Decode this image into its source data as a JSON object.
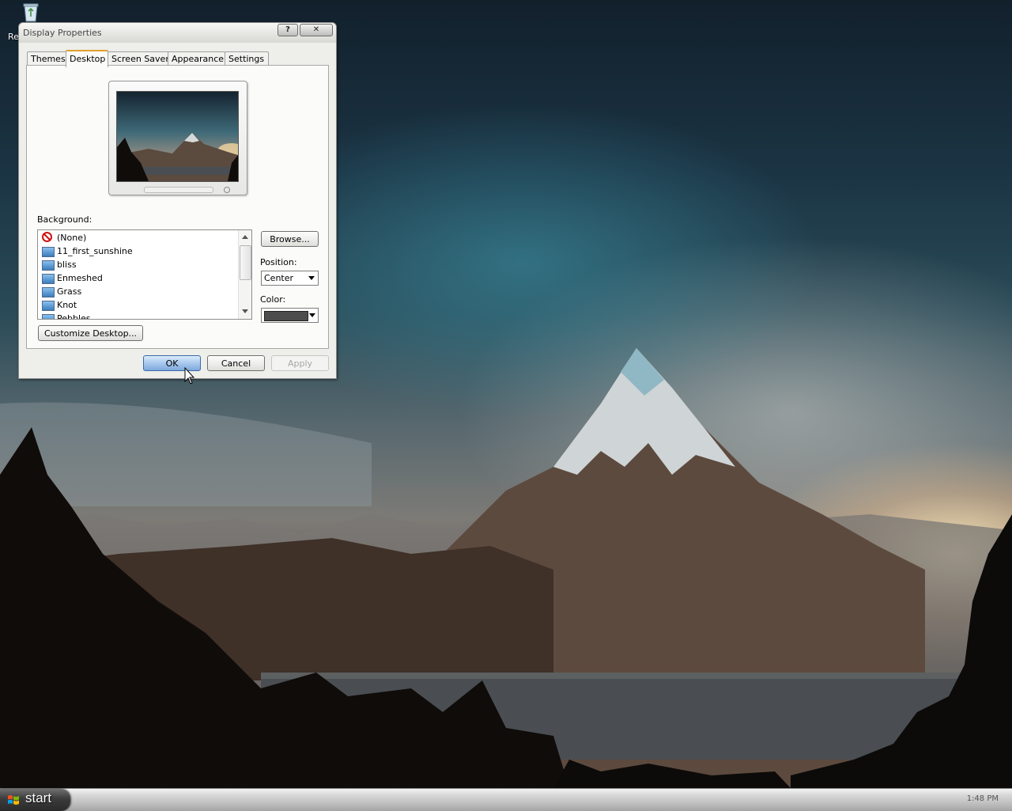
{
  "desktop": {
    "recycle_bin_label": "Re"
  },
  "dialog": {
    "title": "Display Properties",
    "title_buttons": {
      "help": "?",
      "close": "✕"
    },
    "tabs": [
      {
        "label": "Themes",
        "active": false
      },
      {
        "label": "Desktop",
        "active": true
      },
      {
        "label": "Screen Saver",
        "active": false
      },
      {
        "label": "Appearance",
        "active": false
      },
      {
        "label": "Settings",
        "active": false
      }
    ],
    "background_label": "Background:",
    "background_items": [
      {
        "label": "(None)",
        "icon": "no-entry-icon"
      },
      {
        "label": "11_first_sunshine",
        "icon": "image-thumbnail-icon"
      },
      {
        "label": "bliss",
        "icon": "image-thumbnail-icon"
      },
      {
        "label": "Enmeshed",
        "icon": "image-thumbnail-icon"
      },
      {
        "label": "Grass",
        "icon": "image-thumbnail-icon"
      },
      {
        "label": "Knot",
        "icon": "image-thumbnail-icon"
      },
      {
        "label": "Pebbles",
        "icon": "image-thumbnail-icon"
      }
    ],
    "browse_label": "Browse...",
    "position_label": "Position:",
    "position_value": "Center",
    "color_label": "Color:",
    "color_value": "#4c4c4c",
    "customize_label": "Customize Desktop...",
    "ok_label": "OK",
    "cancel_label": "Cancel",
    "apply_label": "Apply"
  },
  "taskbar": {
    "start_label": "start",
    "clock": "1:48 PM"
  }
}
